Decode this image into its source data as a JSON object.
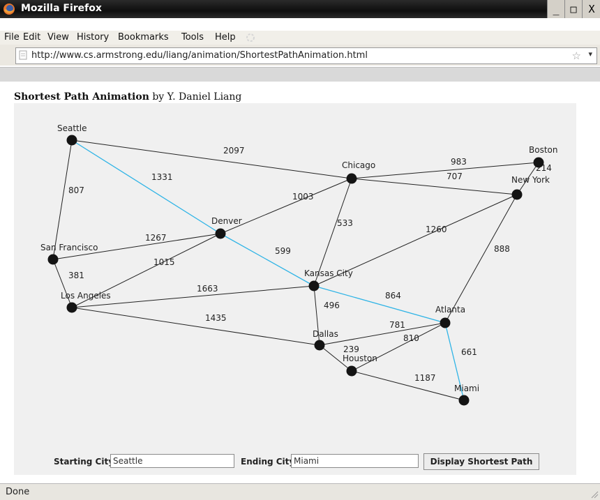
{
  "window": {
    "title": "Mozilla Firefox",
    "minimize": "_",
    "maximize": "□",
    "close": "X"
  },
  "menu": [
    "File",
    "Edit",
    "View",
    "History",
    "Bookmarks",
    "Tools",
    "Help"
  ],
  "address": {
    "url": "http://www.cs.armstrong.edu/liang/animation/ShortestPathAnimation.html",
    "star": "☆",
    "dropdown": "▾"
  },
  "page": {
    "heading_bold": "Shortest Path Animation",
    "heading_rest": " by Y. Daniel Liang"
  },
  "graph": {
    "cities": [
      "Seattle",
      "San Francisco",
      "Los Angeles",
      "Denver",
      "Kansas City",
      "Chicago",
      "Boston",
      "New York",
      "Atlanta",
      "Miami",
      "Dallas",
      "Houston"
    ],
    "edges": [
      {
        "from": "Seattle",
        "to": "San Francisco",
        "weight": "807"
      },
      {
        "from": "Seattle",
        "to": "Chicago",
        "weight": "2097"
      },
      {
        "from": "Seattle",
        "to": "Denver",
        "weight": "1331"
      },
      {
        "from": "San Francisco",
        "to": "Denver",
        "weight": "1267"
      },
      {
        "from": "San Francisco",
        "to": "Los Angeles",
        "weight": "381"
      },
      {
        "from": "Los Angeles",
        "to": "Denver",
        "weight": "1015"
      },
      {
        "from": "Los Angeles",
        "to": "Kansas City",
        "weight": "1663"
      },
      {
        "from": "Los Angeles",
        "to": "Dallas",
        "weight": "1435"
      },
      {
        "from": "Denver",
        "to": "Chicago",
        "weight": "1003"
      },
      {
        "from": "Denver",
        "to": "Kansas City",
        "weight": "599"
      },
      {
        "from": "Kansas City",
        "to": "Chicago",
        "weight": "533"
      },
      {
        "from": "Kansas City",
        "to": "New York",
        "weight": "1260"
      },
      {
        "from": "Kansas City",
        "to": "Atlanta",
        "weight": "864"
      },
      {
        "from": "Kansas City",
        "to": "Dallas",
        "weight": "496"
      },
      {
        "from": "Chicago",
        "to": "Boston",
        "weight": "983"
      },
      {
        "from": "Chicago",
        "to": "New York",
        "weight": "707"
      },
      {
        "from": "Boston",
        "to": "New York",
        "weight": "214"
      },
      {
        "from": "New York",
        "to": "Atlanta",
        "weight": "888"
      },
      {
        "from": "Atlanta",
        "to": "Dallas",
        "weight": "781"
      },
      {
        "from": "Atlanta",
        "to": "Houston",
        "weight": "810"
      },
      {
        "from": "Atlanta",
        "to": "Miami",
        "weight": "661"
      },
      {
        "from": "Dallas",
        "to": "Houston",
        "weight": "239"
      },
      {
        "from": "Houston",
        "to": "Miami",
        "weight": "1187"
      }
    ],
    "shortest_path": [
      "Seattle",
      "Denver",
      "Kansas City",
      "Atlanta",
      "Miami"
    ],
    "colors": {
      "path": "#2fb4e6",
      "edge": "#222222",
      "node": "#141414",
      "panel": "#f0f0f0"
    }
  },
  "controls": {
    "start_label": "Starting City:",
    "start_value": "Seattle",
    "end_label": "Ending City:",
    "end_value": "Miami",
    "button_label": "Display Shortest Path"
  },
  "status": {
    "text": "Done"
  }
}
